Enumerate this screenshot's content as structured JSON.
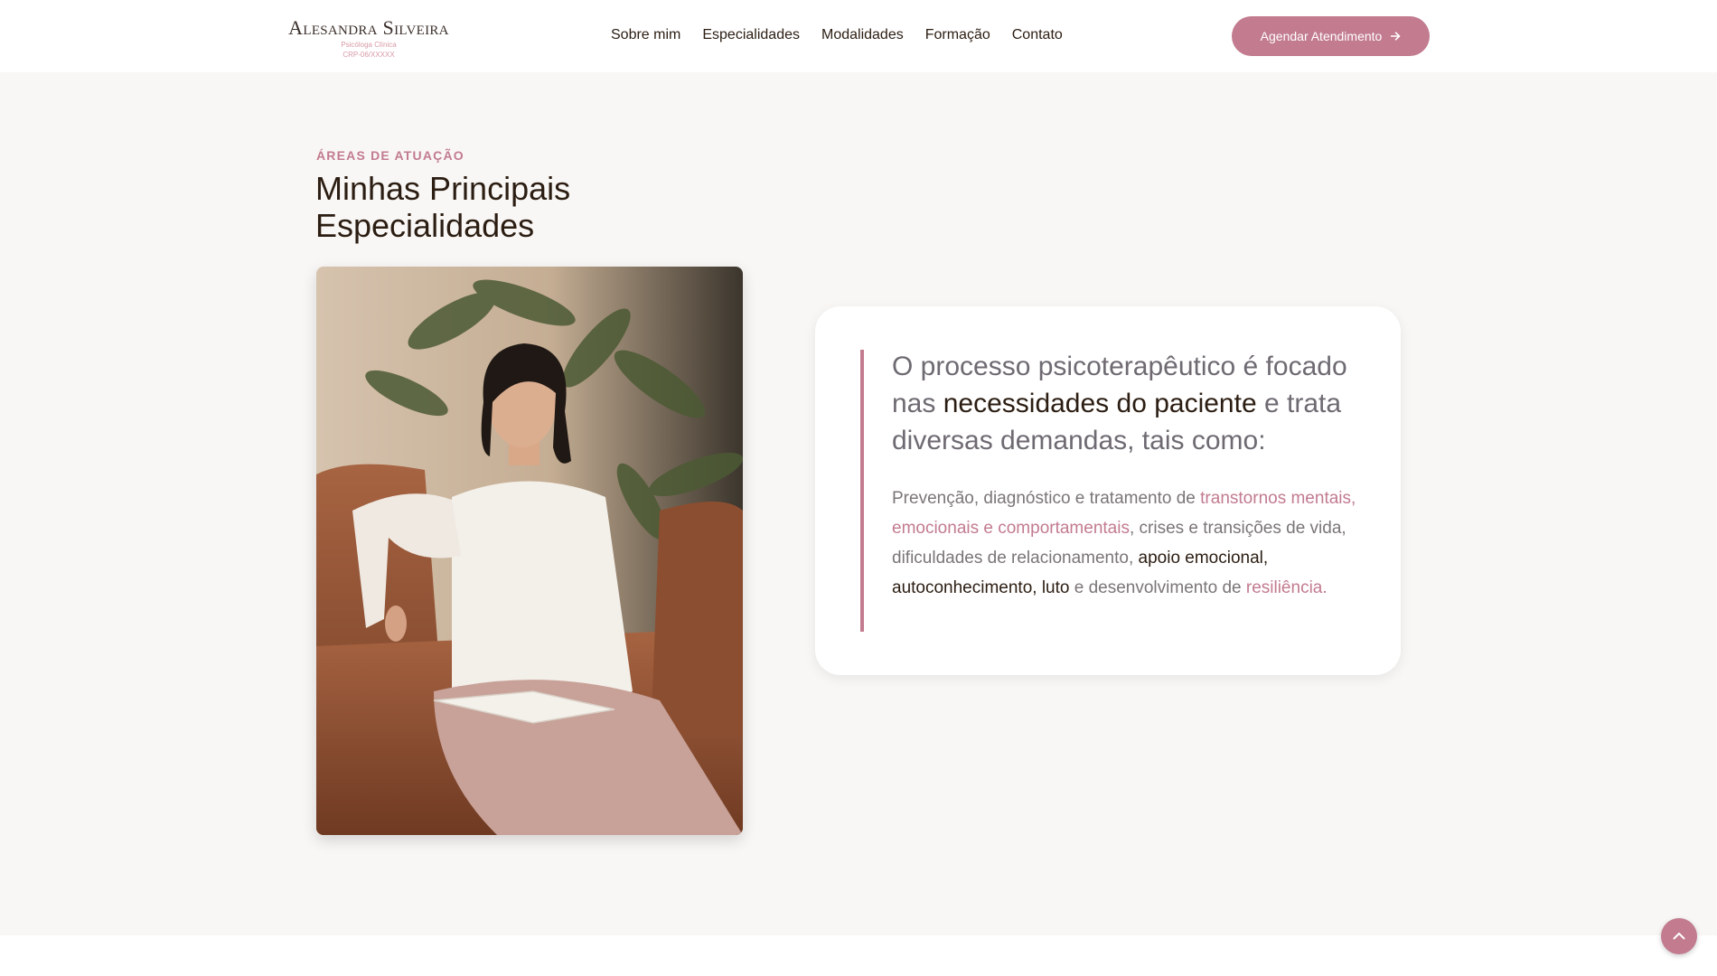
{
  "header": {
    "logo": {
      "name": "Alesandra Silveira",
      "subtitle": "Psicóloga Clínica",
      "crp": "CRP-06/XXXXX"
    },
    "nav": [
      "Sobre mim",
      "Especialidades",
      "Modalidades",
      "Formação",
      "Contato"
    ],
    "cta_label": "Agendar Atendimento"
  },
  "section": {
    "eyebrow": "ÁREAS DE ATUAÇÃO",
    "title": "Minhas Principais Especialidades",
    "quote": {
      "lead_1": "O processo psicoterapêutico é focado nas ",
      "lead_strong": "necessidades do paciente",
      "lead_2": " e trata diversas demandas, tais como:",
      "body_1": "Prevenção, diagnóstico e tratamento de ",
      "body_pink_1": "transtornos mentais, emocionais e comportamentais",
      "body_2": ", crises e transições de vida, dificuldades de relacionamento, ",
      "body_dark": "apoio emocional, autoconhecimento, luto",
      "body_3": " e desenvolvimento de ",
      "body_pink_2": "resiliência",
      "body_4": "."
    }
  },
  "icons": {
    "cta_arrow": "arrow-right-icon",
    "back_to_top": "chevron-up-icon",
    "quote": "quote-mark-icon"
  },
  "colors": {
    "accent": "#c27b8f",
    "text_dark": "#2b1d12",
    "text_muted": "#7b7577",
    "section_bg": "#f9f7f5"
  }
}
